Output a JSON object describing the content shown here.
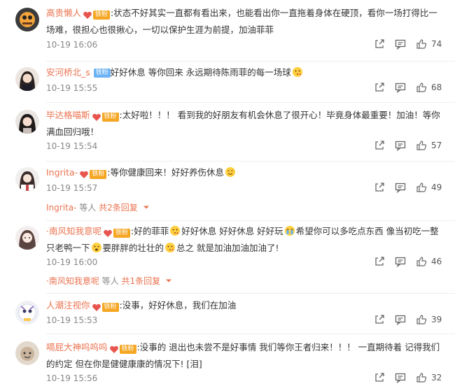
{
  "comments": [
    {
      "username": "高贵懒人",
      "fan_label": "铁粉",
      "text": ":状态不好其实一直都有看出来，也能看出你一直拖着身体在硬顶，看你一场打得比一场难，很担心也很揪心，一切以保护生涯为前提，加油菲菲",
      "date": "10-19 16:06",
      "likes": "74"
    },
    {
      "username": "安河桥北_s",
      "fan_label": "铁粉",
      "text": "好好休息 等你回来 永远期待陈雨菲的每一场球",
      "date": "10-19 15:55",
      "likes": "68"
    },
    {
      "username": "毕达格喵斯",
      "fan_label": "铁粉",
      "text": ":太好啦！！！ 看到我的好朋友有机会休息了很开心！毕竟身体最重要！加油！等你满血回归哦！",
      "date": "10-19 15:54",
      "likes": "57"
    },
    {
      "username": "Ingrita-",
      "fan_label": "铁粉",
      "text": ":等你健康回来！好好养伤休息",
      "date": "10-19 15:57",
      "likes": "49",
      "reply": {
        "name": "Ingrita-",
        "middle": " 等人 ",
        "link": "共2条回复"
      }
    },
    {
      "username": "·南风知我意呢",
      "fan_label": "铁粉",
      "text_parts": [
        ":好的菲菲",
        "好好休息 好好休息 好好玩",
        "希望你可以多吃点东西 像当初吃一整只老鸭一下",
        "要胖胖的壮壮的",
        "总之 就是加油加油加油了!"
      ],
      "date": "10-19 16:00",
      "likes": "46",
      "reply": {
        "name": "·南风知我意呢",
        "middle": " 等人 ",
        "link": "共1条回复"
      }
    },
    {
      "username": "人潮注视你",
      "fan_label": "铁粉",
      "text": ":没事，好好休息，我们在加油",
      "date": "10-19 15:53",
      "likes": "39"
    },
    {
      "username": "嗝屁大神呜呜呜",
      "fan_label": "铁粉",
      "text": ":没事的 退出也未尝不是好事情 我们等你王者归来！！！ 一直期待着 记得我们的约定 但在你是健健康康的情况下! [泪]",
      "date": "10-19 15:56",
      "likes": "32"
    }
  ],
  "icons": {
    "share": "share-icon",
    "comment": "comment-icon",
    "like": "like-icon",
    "expand": "chevron-down-icon"
  },
  "colors": {
    "username": "#eb7350",
    "fan_badge": "#f5a623",
    "fan_badge_alt": "#6bb3f4",
    "meta": "#888888"
  }
}
